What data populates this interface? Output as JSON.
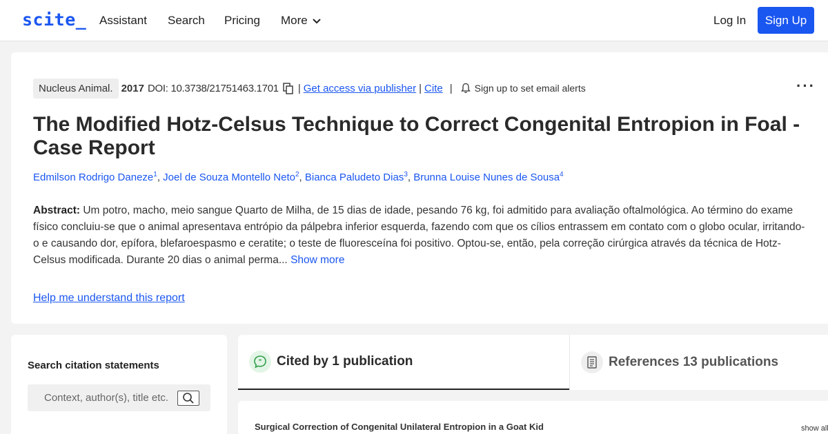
{
  "header": {
    "logo": "scite_",
    "nav": [
      "Assistant",
      "Search",
      "Pricing",
      "More"
    ],
    "login": "Log In",
    "signup": "Sign Up"
  },
  "paper": {
    "journal": "Nucleus Animal.",
    "year": "2017",
    "doi": "DOI: 10.3738/21751463.1701",
    "access_link": "Get access via publisher",
    "cite_link": "Cite",
    "alerts": "Sign up to set email alerts",
    "title": "The Modified Hotz-Celsus Technique to Correct Congenital Entropion in Foal - Case Report",
    "authors": [
      {
        "name": "Edmilson Rodrigo Daneze",
        "sup": "1"
      },
      {
        "name": "Joel de Souza Montello Neto",
        "sup": "2"
      },
      {
        "name": "Bianca Paludeto Dias",
        "sup": "3"
      },
      {
        "name": "Brunna Louise Nunes de Sousa",
        "sup": "4"
      }
    ],
    "abstract_label": "Abstract:",
    "abstract_text": "Um potro, macho, meio sangue Quarto de Milha, de 15 dias de idade, pesando 76 kg, foi admitido para avaliação oftalmológica. Ao término do exame físico concluiu-se que o animal apresentava entrópio da pálpebra inferior esquerda, fazendo com que os cílios entrassem em contato com o globo ocular, irritando-o e causando dor, epífora, blefaroespasmo e ceratite; o teste de fluoresceína foi positivo. Optou-se, então, pela correção cirúrgica através da técnica de Hotz-Celsus modificada. Durante 20 dias o animal perma...",
    "show_more": "Show more",
    "help_link": "Help me understand this report"
  },
  "search": {
    "title": "Search citation statements",
    "placeholder": "Context, author(s), title etc."
  },
  "tabs": {
    "cited": "Cited by 1 publication",
    "references": "References 13 publications"
  },
  "citation": {
    "title": "Surgical Correction of Congenital Unilateral Entropion in a Goat Kid",
    "show_all": "show all"
  },
  "colors": {
    "accent": "#1a56f0",
    "cited_icon": "#2e9e4a"
  }
}
